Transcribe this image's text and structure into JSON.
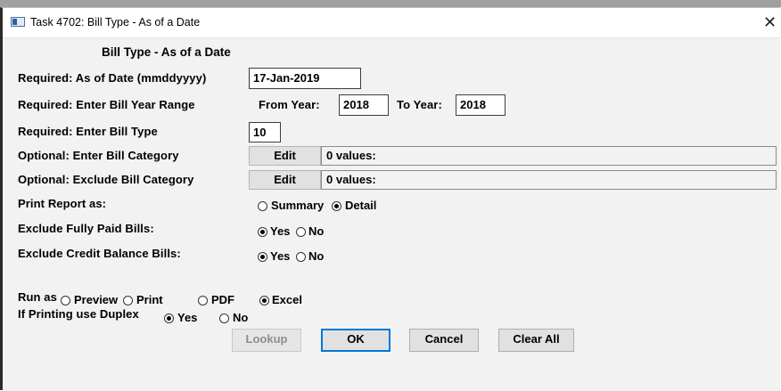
{
  "window": {
    "title": "Task 4702: Bill Type - As of a Date",
    "icon": "window-app-icon",
    "close_glyph": "✕"
  },
  "form": {
    "heading": "Bill Type - As of a Date",
    "as_of_date": {
      "label": "Required: As of Date (mmddyyyy)",
      "value": "17-Jan-2019"
    },
    "year_range": {
      "label": "Required: Enter Bill Year Range",
      "from_label": "From Year:",
      "from_value": "2018",
      "to_label": "To Year:",
      "to_value": "2018"
    },
    "bill_type": {
      "label": "Required: Enter Bill Type",
      "value": "10"
    },
    "bill_category": {
      "label": "Optional: Enter Bill Category",
      "edit_label": "Edit",
      "values_text": "0 values:"
    },
    "exclude_category": {
      "label": "Optional: Exclude Bill Category",
      "edit_label": "Edit",
      "values_text": "0 values:"
    },
    "print_report_as": {
      "label": "Print Report as:",
      "options": [
        "Summary",
        "Detail"
      ],
      "selected": "Detail"
    },
    "exclude_paid": {
      "label": "Exclude Fully Paid Bills:",
      "options": [
        "Yes",
        "No"
      ],
      "selected": "Yes"
    },
    "exclude_credit": {
      "label": "Exclude Credit Balance Bills:",
      "options": [
        "Yes",
        "No"
      ],
      "selected": "Yes"
    },
    "run_as": {
      "label": "Run as",
      "options": [
        "Preview",
        "Print",
        "PDF",
        "Excel"
      ],
      "selected": "Excel"
    },
    "duplex": {
      "label": "If Printing use Duplex",
      "options": [
        "Yes",
        "No"
      ],
      "selected": "Yes"
    }
  },
  "buttons": {
    "lookup": "Lookup",
    "ok": "OK",
    "cancel": "Cancel",
    "clear_all": "Clear All"
  },
  "colors": {
    "form_background": "#f2f2f2",
    "default_button_border": "#0078d7"
  }
}
